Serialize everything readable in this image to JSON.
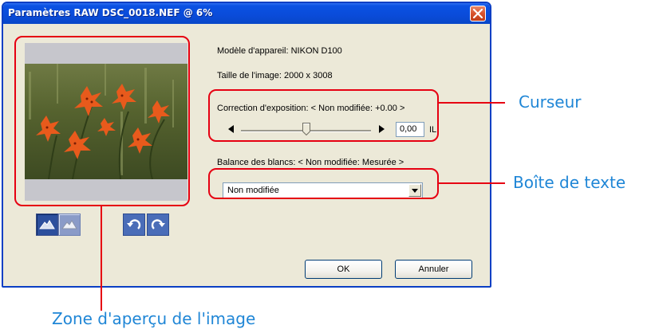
{
  "window": {
    "title": "Paramètres RAW DSC_0018.NEF @ 6%"
  },
  "info": {
    "camera_model": "Modèle d'appareil: NIKON D100",
    "image_size": "Taille de l'image: 2000 x 3008",
    "exposure_label": "Correction d'exposition: < Non modifiée: +0.00 >",
    "white_balance_label": "Balance des blancs: < Non modifiée: Mesurée >"
  },
  "exposure": {
    "value": "0,00",
    "unit": "IL",
    "slider_fraction": 0.5
  },
  "white_balance": {
    "selected": "Non modifiée"
  },
  "buttons": {
    "ok": "OK",
    "cancel": "Annuler"
  },
  "annotations": {
    "slider": "Curseur",
    "textbox": "Boîte de texte",
    "preview": "Zone d'aperçu de l'image"
  },
  "icons": {
    "close": "close-icon",
    "tool1": "mountain-icon",
    "tool2": "mountain-outline-icon",
    "rotate_ccw": "rotate-left-icon",
    "rotate_cw": "rotate-right-icon"
  },
  "colors": {
    "titlebar": "#0a4bd9",
    "dialog_bg": "#ece9d8",
    "highlight": "#e60012",
    "annotation_text": "#1f86d6"
  }
}
